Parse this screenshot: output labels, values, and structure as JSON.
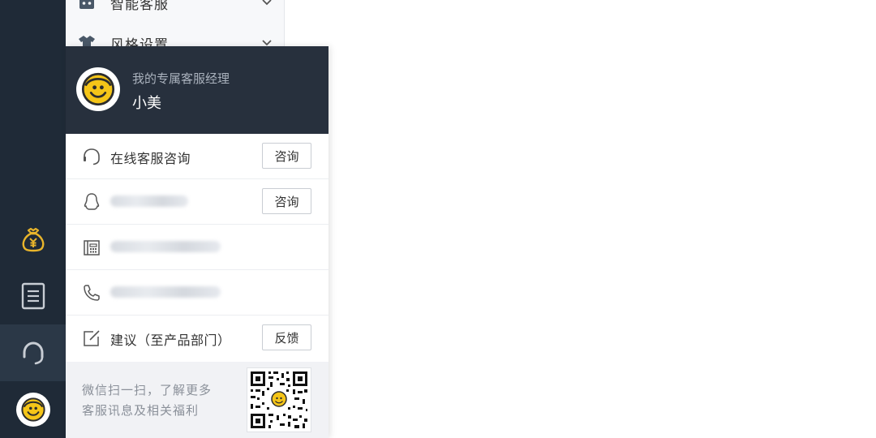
{
  "sidebar": {
    "items": [
      {
        "label": "智能客服",
        "icon": "robot-icon"
      },
      {
        "label": "风格设置",
        "icon": "shirt-icon"
      }
    ]
  },
  "rail": {
    "items": [
      {
        "icon": "money-bag-icon",
        "color": "#e9b52b"
      },
      {
        "icon": "document-icon"
      },
      {
        "icon": "headset-icon",
        "active": true
      },
      {
        "icon": "smiley-avatar-icon"
      }
    ]
  },
  "panel": {
    "header": {
      "subtitle": "我的专属客服经理",
      "name": "小美"
    },
    "rows": [
      {
        "icon": "headset-icon",
        "label": "在线客服咨询",
        "button": "咨询"
      },
      {
        "icon": "qq-penguin-icon",
        "label": "",
        "blurred": true,
        "button": "咨询"
      },
      {
        "icon": "fax-icon",
        "label": "",
        "blurred": true
      },
      {
        "icon": "phone-icon",
        "label": "",
        "blurred": true
      },
      {
        "icon": "edit-icon",
        "label": "建议（至产品部门）",
        "button": "反馈"
      }
    ],
    "footer": {
      "line1": "微信扫一扫，了解更多",
      "line2": "客服讯息及相关福利",
      "qr_icon": "wechat-qr-code"
    }
  },
  "colors": {
    "rail_bg": "#1f2a37",
    "header_bg": "#27303d",
    "accent_yellow": "#f5c518"
  }
}
